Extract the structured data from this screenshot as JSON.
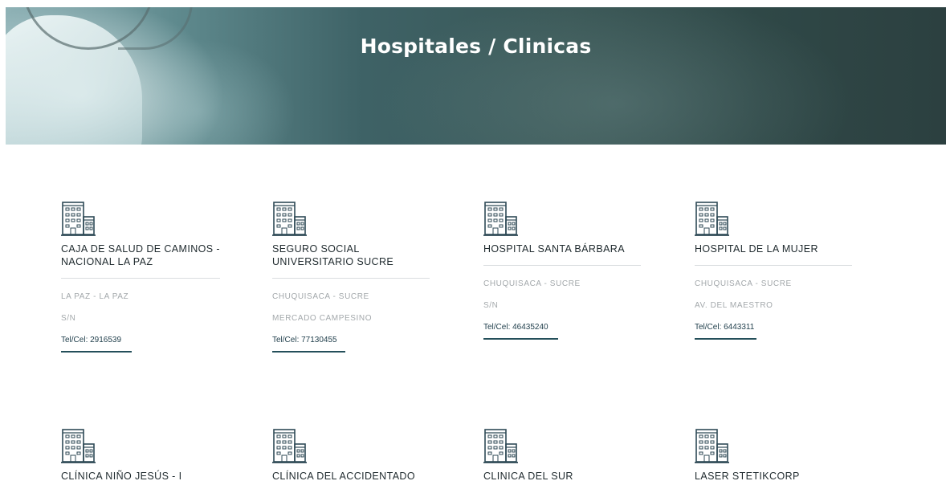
{
  "header": {
    "title": "Hospitales / Clinicas"
  },
  "cards": [
    {
      "name": "CAJA DE SALUD DE CAMINOS - NACIONAL LA PAZ",
      "location": "LA PAZ - LA PAZ",
      "address": "S/N",
      "phone": "Tel/Cel: 2916539"
    },
    {
      "name": "SEGURO SOCIAL UNIVERSITARIO SUCRE",
      "location": "CHUQUISACA - SUCRE",
      "address": "MERCADO CAMPESINO",
      "phone": "Tel/Cel: 77130455"
    },
    {
      "name": "HOSPITAL SANTA BÁRBARA",
      "location": "CHUQUISACA - SUCRE",
      "address": "S/N",
      "phone": "Tel/Cel: 46435240"
    },
    {
      "name": "HOSPITAL DE LA MUJER",
      "location": "CHUQUISACA - SUCRE",
      "address": "AV. DEL MAESTRO",
      "phone": "Tel/Cel: 6443311"
    },
    {
      "name": "CLÍNICA NIÑO JESÚS - I"
    },
    {
      "name": "CLÍNICA DEL ACCIDENTADO"
    },
    {
      "name": "CLINICA DEL SUR"
    },
    {
      "name": "LASER STETIKCORP"
    }
  ],
  "colors": {
    "text": "#1f2a2e",
    "muted": "#a3a8ab",
    "accent": "#244f5a"
  },
  "icons": {
    "card_icon": "hospital-building-icon"
  }
}
